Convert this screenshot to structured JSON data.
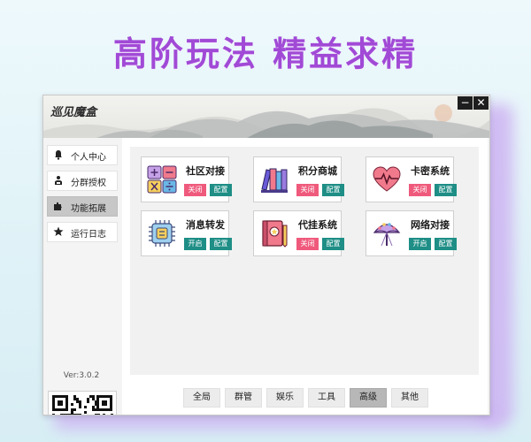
{
  "headline": "高阶玩法  精益求精",
  "app": {
    "title": "巡见魔盒",
    "minimize_label": "−",
    "close_label": "✕"
  },
  "sidebar": {
    "items": [
      {
        "label": "个人中心",
        "icon": "bell-icon",
        "active": false
      },
      {
        "label": "分群授权",
        "icon": "people-icon",
        "active": false
      },
      {
        "label": "功能拓展",
        "icon": "puzzle-icon",
        "active": true
      },
      {
        "label": "运行日志",
        "icon": "star-icon",
        "active": false
      }
    ],
    "version": "Ver:3.0.2"
  },
  "features": [
    {
      "name": "社区对接",
      "toggle": "关闭",
      "toggle_state": "off",
      "config": "配置",
      "icon": "grid-calculator-icon"
    },
    {
      "name": "积分商城",
      "toggle": "关闭",
      "toggle_state": "off",
      "config": "配置",
      "icon": "books-icon"
    },
    {
      "name": "卡密系统",
      "toggle": "关闭",
      "toggle_state": "off",
      "config": "配置",
      "icon": "heart-pulse-icon"
    },
    {
      "name": "消息转发",
      "toggle": "开启",
      "toggle_state": "on",
      "config": "配置",
      "icon": "chip-icon"
    },
    {
      "name": "代挂系统",
      "toggle": "关闭",
      "toggle_state": "off",
      "config": "配置",
      "icon": "notebook-icon"
    },
    {
      "name": "网络对接",
      "toggle": "开启",
      "toggle_state": "on",
      "config": "配置",
      "icon": "fan-icon"
    }
  ],
  "tabs": [
    {
      "label": "全局",
      "active": false
    },
    {
      "label": "群管",
      "active": false
    },
    {
      "label": "娱乐",
      "active": false
    },
    {
      "label": "工具",
      "active": false
    },
    {
      "label": "高级",
      "active": true
    },
    {
      "label": "其他",
      "active": false
    }
  ],
  "colors": {
    "headline": "#a14ad6",
    "toggle_off": "#ef5a7c",
    "toggle_on": "#1e8e86",
    "config": "#1e8e86"
  }
}
